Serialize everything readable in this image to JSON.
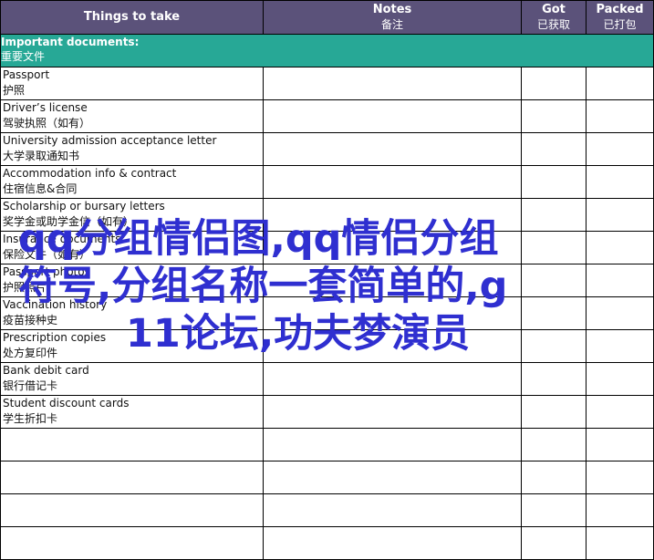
{
  "headers": {
    "things": "Things to take",
    "notes_en": "Notes",
    "notes_cn": "备注",
    "got_en": "Got",
    "got_cn": "已获取",
    "packed_en": "Packed",
    "packed_cn": "已打包"
  },
  "section": {
    "title_en": "Important documents:",
    "title_cn": "重要文件"
  },
  "items": [
    {
      "en": "Passport",
      "cn": "护照"
    },
    {
      "en": "Driver’s license",
      "cn": "驾驶执照（如有）"
    },
    {
      "en": "University admission acceptance letter",
      "cn": "大学录取通知书"
    },
    {
      "en": "Accommodation info & contract",
      "cn": "住宿信息&合同"
    },
    {
      "en": "Scholarship or bursary letters",
      "cn": "奖学金或助学金信（如有）"
    },
    {
      "en": "Insurance documents",
      "cn": "保险文件（如有）"
    },
    {
      "en": "Passport photos",
      "cn": "护照照片"
    },
    {
      "en": "Vaccination history",
      "cn": "疫苗接种史"
    },
    {
      "en": "Prescription copies",
      "cn": "处方复印件"
    },
    {
      "en": "Bank debit card",
      "cn": "银行借记卡"
    },
    {
      "en": "Student discount cards",
      "cn": "学生折扣卡"
    },
    {
      "en": "",
      "cn": ""
    },
    {
      "en": "",
      "cn": ""
    },
    {
      "en": "",
      "cn": ""
    },
    {
      "en": "",
      "cn": ""
    }
  ],
  "watermark": {
    "line1": "qq分组情侣图,qq情侣分组",
    "line2": "符号,分组名称一套简单的,g",
    "line3": "11论坛,功夫梦演员"
  }
}
